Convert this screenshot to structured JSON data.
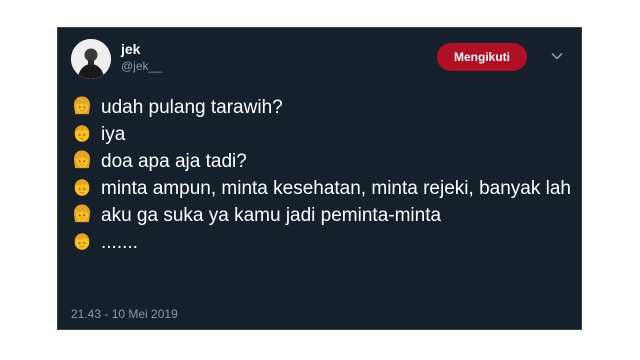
{
  "user": {
    "name": "jek",
    "handle": "@jek__"
  },
  "follow_button_label": "Mengikuti",
  "messages": [
    {
      "speaker": "woman",
      "text": "udah pulang tarawih?"
    },
    {
      "speaker": "man",
      "text": "iya"
    },
    {
      "speaker": "woman",
      "text": "doa apa aja tadi?"
    },
    {
      "speaker": "man",
      "text": "minta ampun, minta kesehatan, minta rejeki, banyak lah"
    },
    {
      "speaker": "woman",
      "text": "aku ga suka ya kamu jadi peminta-minta"
    },
    {
      "speaker": "man",
      "text": "......."
    }
  ],
  "timestamp": "21.43 - 10 Mei 2019",
  "colors": {
    "card_background": "#15202b",
    "follow_button": "#b00f25",
    "secondary_text": "#8899a6"
  },
  "icons": {
    "woman": "woman-emoji-icon",
    "man": "man-emoji-icon",
    "menu": "chevron-down-icon"
  }
}
